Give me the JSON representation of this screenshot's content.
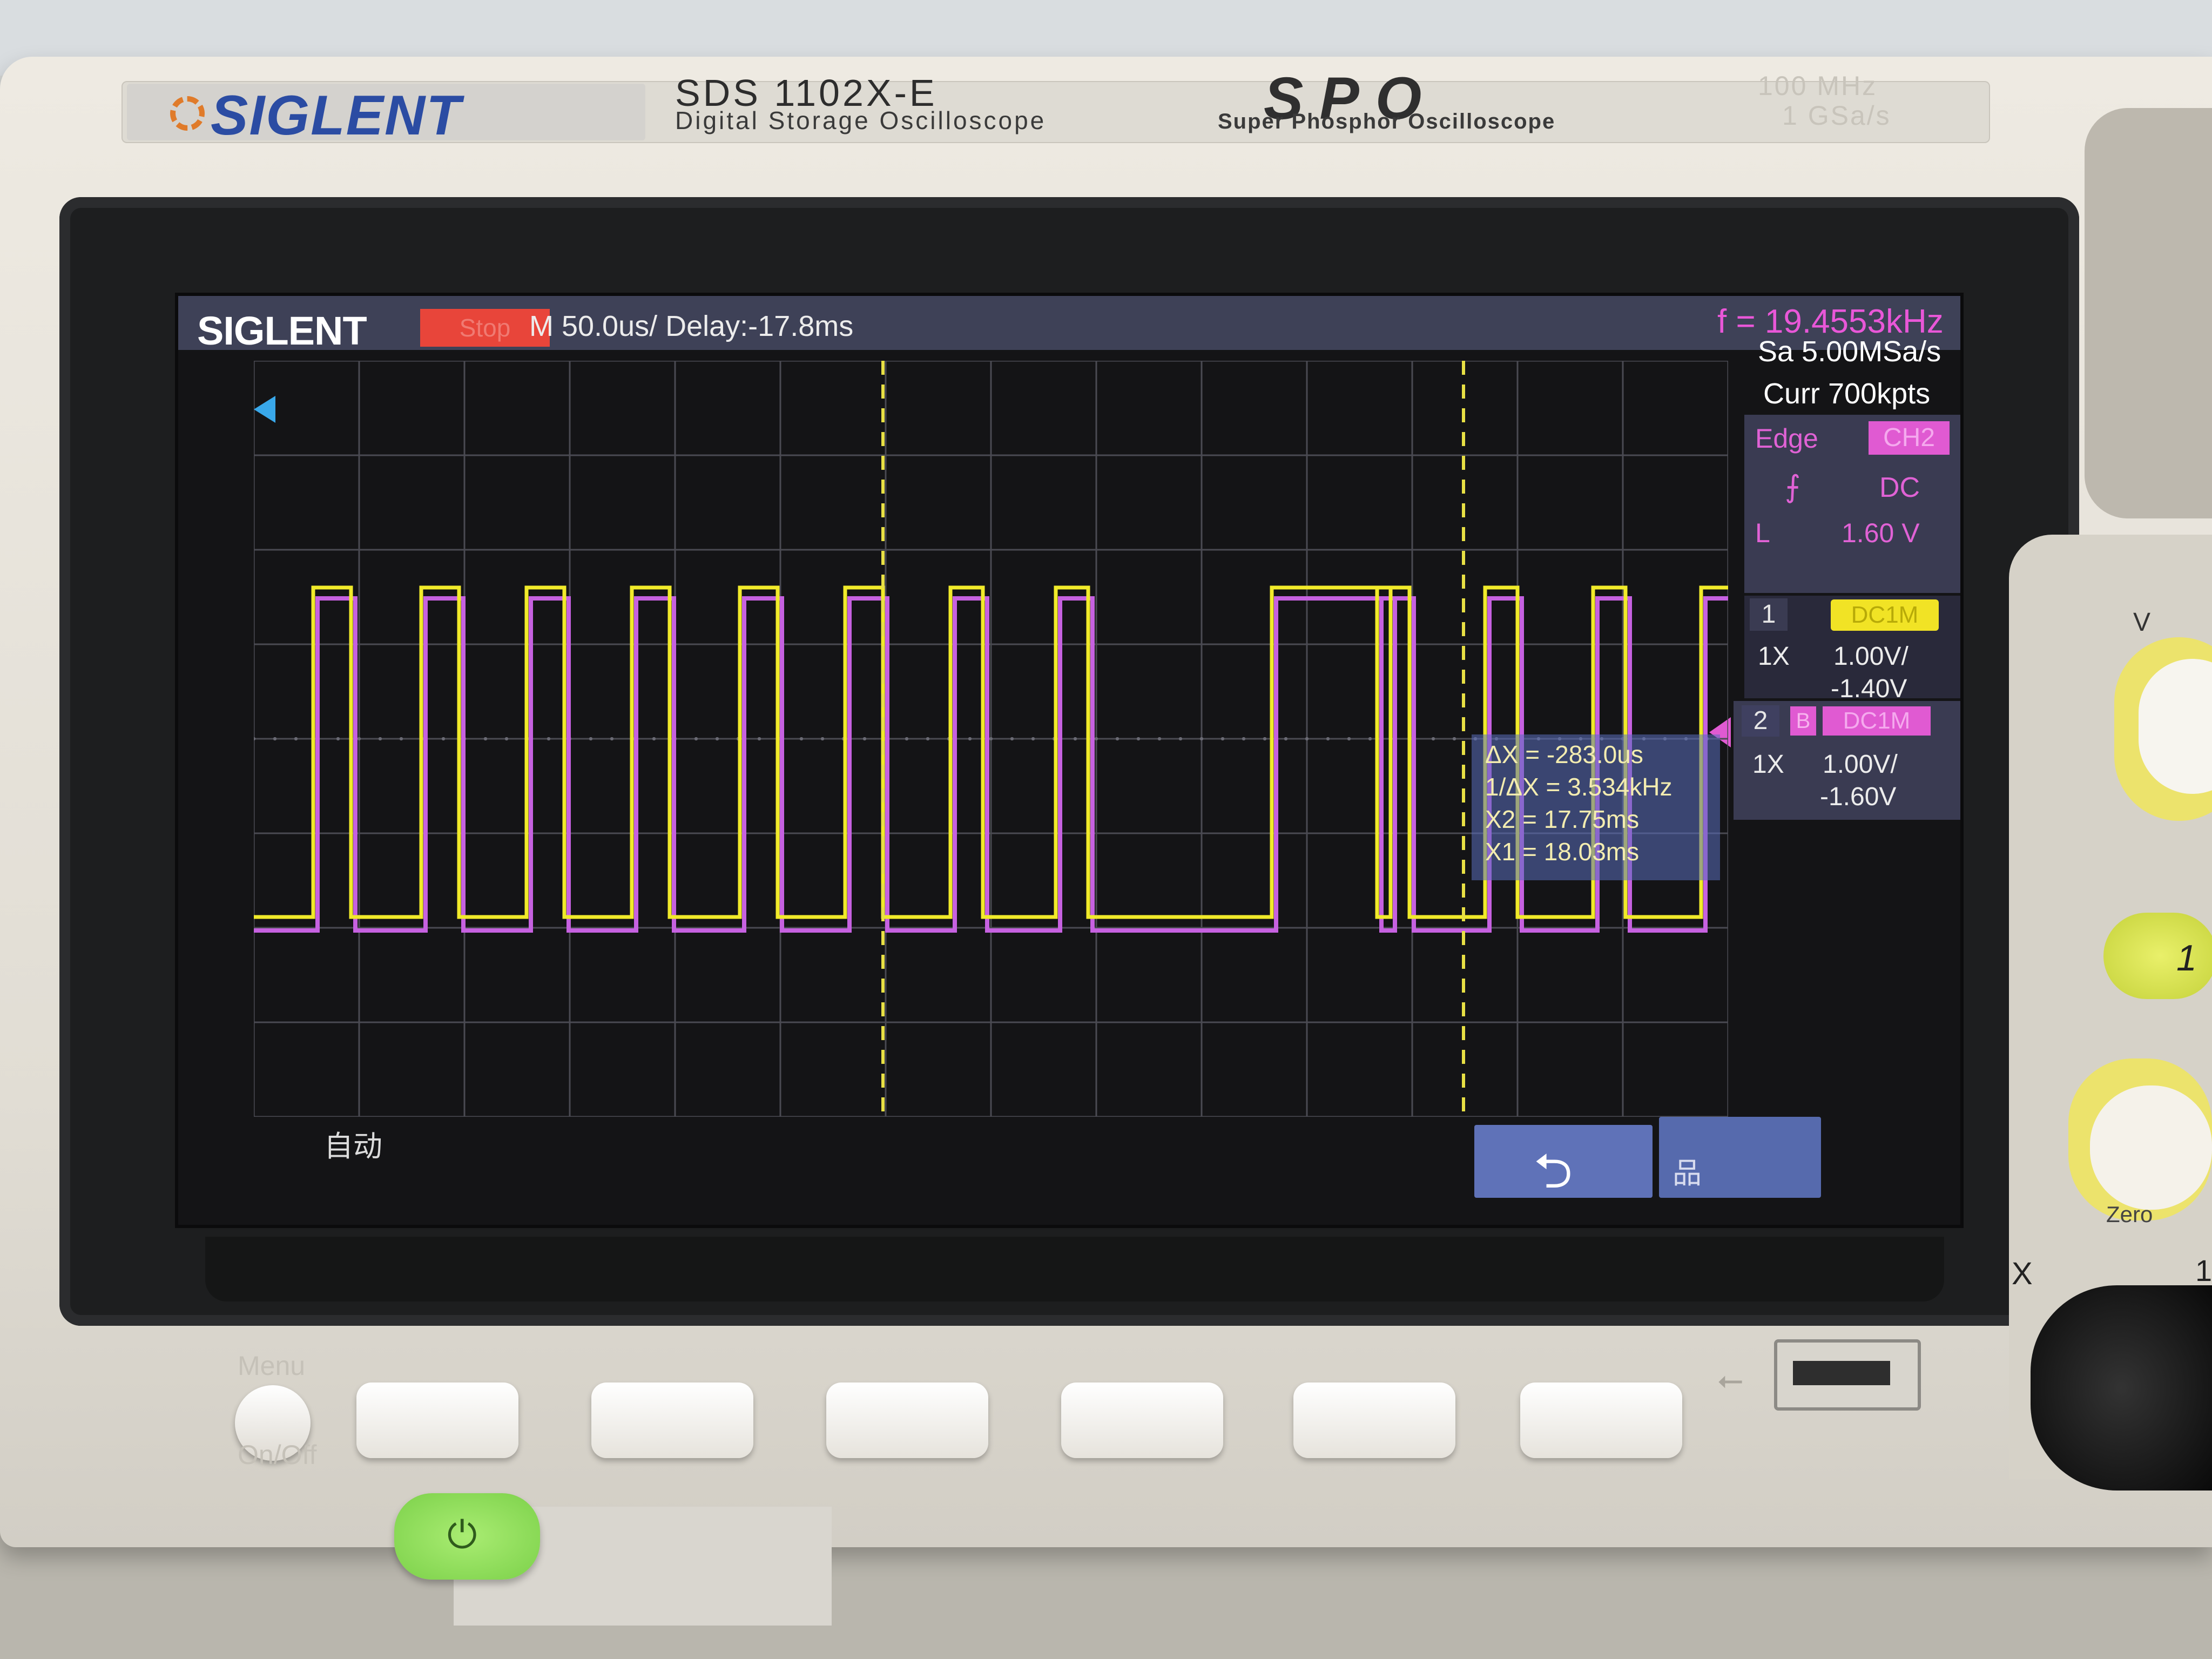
{
  "brand": {
    "logo": "SIGLENT",
    "model": "SDS 1102X-E",
    "model_subtitle": "Digital Storage Oscilloscope",
    "series_logo": "SPO",
    "series_subtitle": "Super Phosphor Oscilloscope",
    "spec_bandwidth": "100 MHz",
    "spec_samplerate": "1 GSa/s"
  },
  "screen": {
    "logo": "SIGLENT",
    "run_state": "Stop",
    "timebase": "M 50.0us/  Delay:-17.8ms",
    "frequency": "f = 19.4553kHz",
    "sample_rate": "Sa 5.00MSa/s",
    "memory": "Curr 700kpts",
    "acquisition_mode": "自动",
    "trigger": {
      "type": "Edge",
      "source": "CH2",
      "slope_icon": "rising-edge-icon",
      "slope_glyph": "⨍",
      "coupling": "DC",
      "level_key": "L",
      "level": "1.60 V"
    },
    "channel1": {
      "number": "1",
      "coupling": "DC1M",
      "probe": "1X",
      "scale": "1.00V/",
      "offset": "-1.40V",
      "color": "#f1e325"
    },
    "channel2": {
      "number": "2",
      "bw_limit": "B",
      "coupling": "DC1M",
      "probe": "1X",
      "scale": "1.00V/",
      "offset": "-1.60V",
      "color": "#e05ad2"
    },
    "measurements": {
      "delta_x": "ΔX = -283.0us",
      "inv_delta_x": "1/ΔX = 3.534kHz",
      "x2": "X2 = 17.75ms",
      "x1": "X1 = 18.03ms"
    },
    "back_icon": "return-arrow-icon",
    "back_glyph": "⮌",
    "network_icon": "network-icon",
    "network_glyph": "品"
  },
  "panel": {
    "menu_label": "Menu",
    "onoff_label": "On/Off",
    "power_glyph": "⏻",
    "usb_glyph": "⭠",
    "ch1_button": "1",
    "zero_label": "Zero",
    "x_label": "X",
    "v_label": "V",
    "one_label": "1"
  }
}
